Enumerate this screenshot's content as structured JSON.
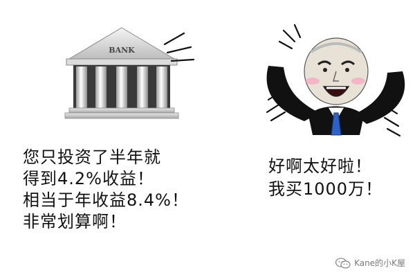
{
  "bank_panel": {
    "sign": "BANK",
    "caption_lines": [
      "您只投资了半年就",
      "得到4.2%收益！",
      "相当于年收益8.4%！",
      "非常划算啊！"
    ]
  },
  "reaction_panel": {
    "caption_lines": [
      "好啊太好啦！",
      "我买1000万！"
    ]
  },
  "watermark": {
    "text": "Kane的小K屋",
    "icon": "wechat-icon"
  }
}
